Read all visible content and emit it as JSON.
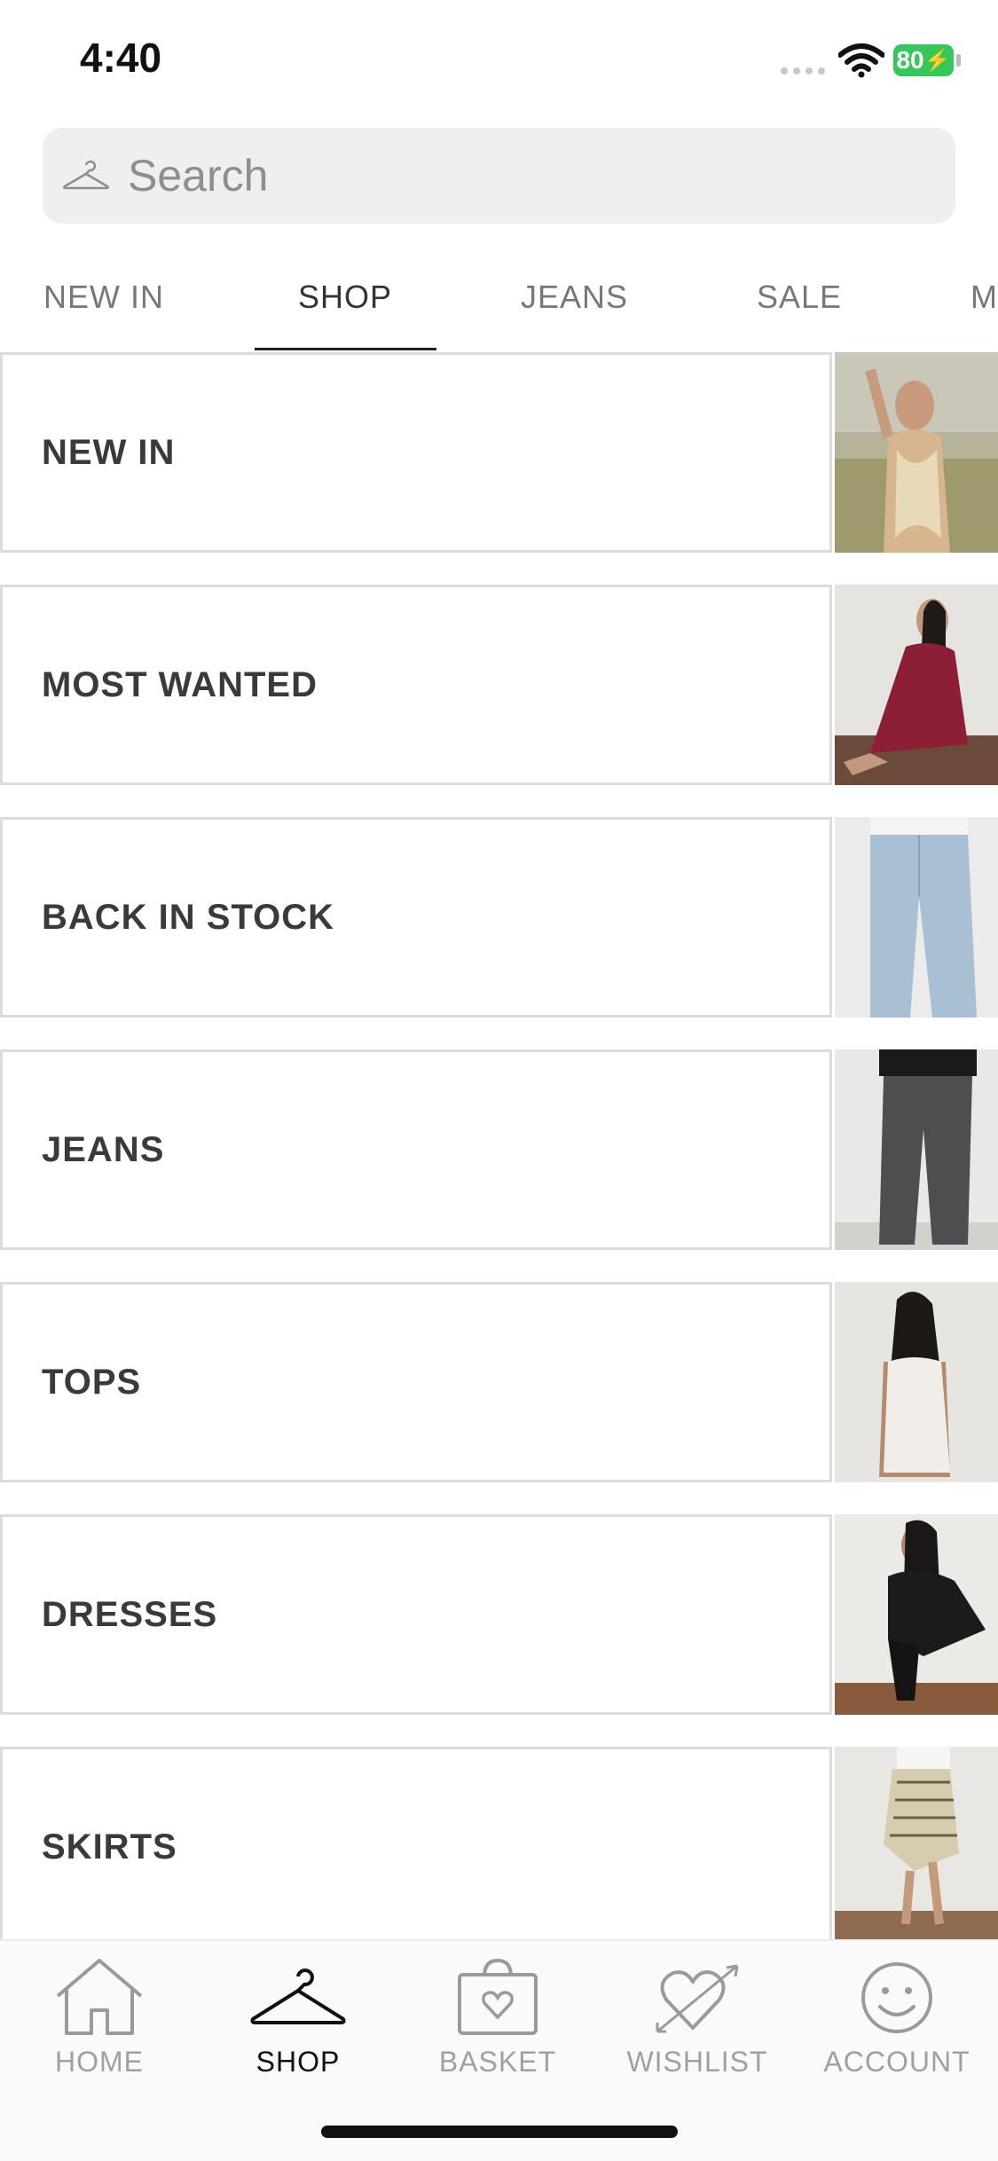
{
  "status_bar": {
    "time": "4:40",
    "battery": "80",
    "battery_color": "#34c759"
  },
  "search": {
    "placeholder": "Search",
    "icon": "hanger-icon"
  },
  "tabs": [
    {
      "label": "NEW IN",
      "active": false
    },
    {
      "label": "SHOP",
      "active": true
    },
    {
      "label": "JEANS",
      "active": false
    },
    {
      "label": "SALE",
      "active": false
    },
    {
      "label": "M",
      "active": false
    }
  ],
  "categories": [
    {
      "label": "NEW IN",
      "image": "model in sequin halter top outdoors"
    },
    {
      "label": "MOST WANTED",
      "image": "model in red lace dress sitting"
    },
    {
      "label": "BACK IN STOCK",
      "image": "light wash jeans"
    },
    {
      "label": "JEANS",
      "image": "dark grey jeans"
    },
    {
      "label": "TOPS",
      "image": "model in white knit top"
    },
    {
      "label": "DRESSES",
      "image": "model in black lace dress crouching"
    },
    {
      "label": "SKIRTS",
      "image": "striped midi skirt"
    }
  ],
  "bottom_nav": [
    {
      "label": "HOME",
      "icon": "home-icon",
      "active": false
    },
    {
      "label": "SHOP",
      "icon": "hanger-icon",
      "active": true
    },
    {
      "label": "BASKET",
      "icon": "basket-heart-icon",
      "active": false
    },
    {
      "label": "WISHLIST",
      "icon": "heart-arrow-icon",
      "active": false
    },
    {
      "label": "ACCOUNT",
      "icon": "smiley-icon",
      "active": false
    }
  ]
}
